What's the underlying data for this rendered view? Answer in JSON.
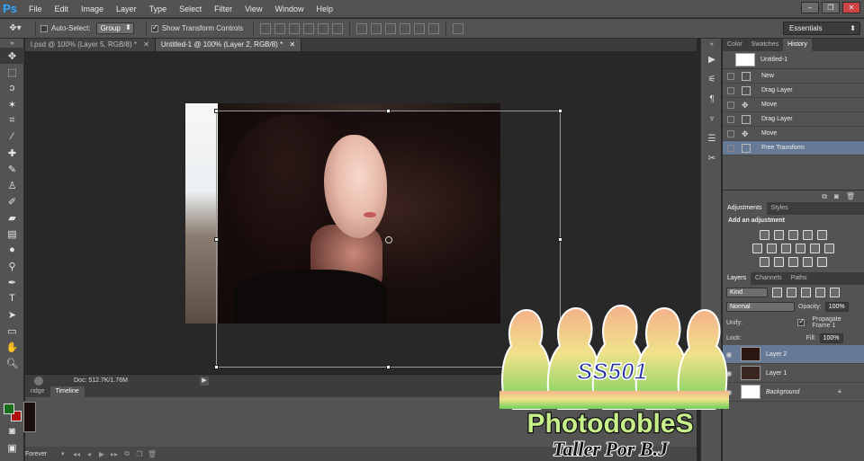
{
  "app": {
    "logo": "Ps"
  },
  "menu": [
    "File",
    "Edit",
    "Image",
    "Layer",
    "Type",
    "Select",
    "Filter",
    "View",
    "Window",
    "Help"
  ],
  "window_buttons": [
    "–",
    "❐",
    "✕"
  ],
  "options": {
    "auto_select_label": "Auto-Select:",
    "auto_select_value": "Group",
    "show_transform_label": "Show Transform Controls",
    "workspace": "Essentials"
  },
  "tabs": [
    {
      "label": "l.psd @ 100% (Layer 5, RGB/8) *",
      "close": "✕"
    },
    {
      "label": "Untitled-1 @ 100% (Layer 2, RGB/8) *",
      "close": "✕"
    }
  ],
  "status": {
    "doc": "Doc: 512.7K/1.76M",
    "arrow": "▶"
  },
  "timeline": {
    "tabs": [
      "ridge",
      "Timeline"
    ],
    "loop": "Forever",
    "buttons": [
      "◂◂",
      "◂",
      "▶",
      "▸▸"
    ]
  },
  "history_panel": {
    "tabs": [
      "Color",
      "Swatches",
      "History"
    ],
    "snapshot": "Untitled-1",
    "steps": [
      "New",
      "Drag Layer",
      "Move",
      "Drag Layer",
      "Move",
      "Free Transform"
    ]
  },
  "adjustments_panel": {
    "tabs": [
      "Adjustments",
      "Styles"
    ],
    "heading": "Add an adjustment"
  },
  "layers_panel": {
    "tabs": [
      "Layers",
      "Channels",
      "Paths"
    ],
    "filter": "Kind",
    "blend_mode": "Normal",
    "opacity_label": "Opacity:",
    "opacity_value": "100%",
    "unify_label": "Unify:",
    "propagate_label": "Propagate Frame 1",
    "lock_label": "Lock:",
    "fill_label": "Fill:",
    "fill_value": "100%",
    "layers": [
      "Layer 2",
      "Layer 1",
      "Background"
    ]
  },
  "watermark": {
    "badge": "SS501",
    "title": "PhotodobleS",
    "subtitle": "Taller Por B.J"
  }
}
